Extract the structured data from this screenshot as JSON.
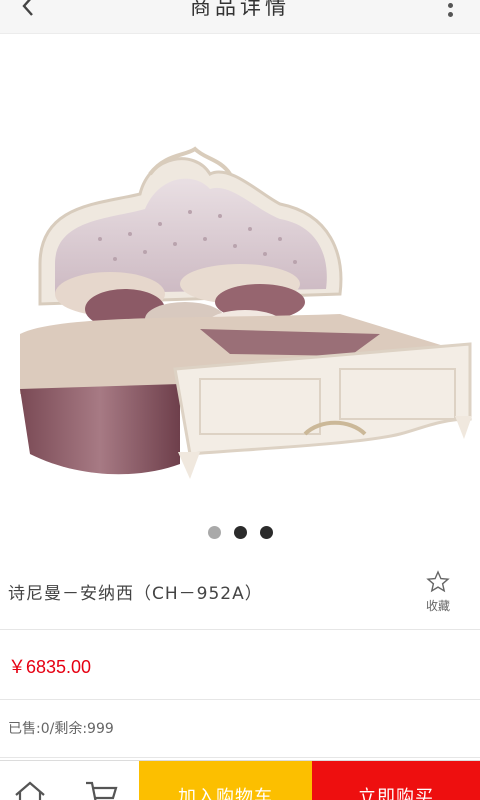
{
  "header": {
    "title": "商品详情",
    "back_icon": "chevron-left-icon",
    "more_icon": "more-vertical-icon"
  },
  "carousel": {
    "image": "bed-product-image",
    "slide_count": 3,
    "active_slide": 2
  },
  "product": {
    "name": "诗尼曼－安纳西（CH－952A）",
    "favorite_label": "收藏",
    "price": "￥6835.00",
    "stock": "已售:0/剩余:999"
  },
  "bottom_bar": {
    "home_icon": "home-icon",
    "cart_icon": "cart-icon",
    "add_to_cart_label": "加入购物车",
    "buy_now_label": "立即购买"
  },
  "colors": {
    "price": "#e60012",
    "add_to_cart_bg": "#fcbf00",
    "buy_now_bg": "#ee0f0f"
  }
}
